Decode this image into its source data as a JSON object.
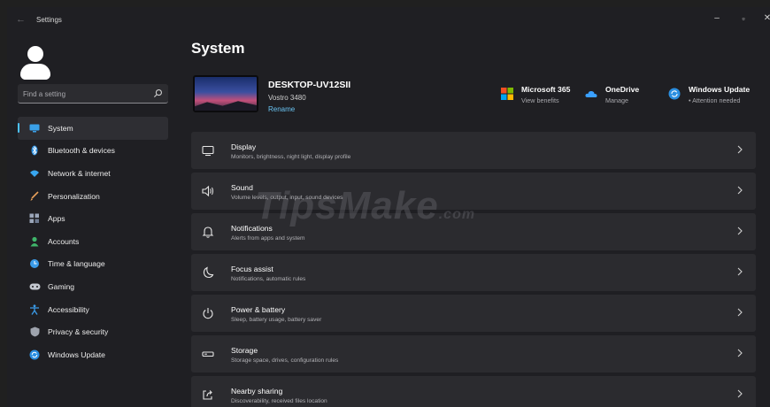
{
  "app": {
    "title": "Settings"
  },
  "window_controls": {
    "minimize": "–",
    "maximize": "▫",
    "close": "✕"
  },
  "search": {
    "placeholder": "Find a setting"
  },
  "sidebar": {
    "items": [
      {
        "label": "System",
        "icon": "display-icon",
        "active": true
      },
      {
        "label": "Bluetooth & devices",
        "icon": "bluetooth-icon"
      },
      {
        "label": "Network & internet",
        "icon": "wifi-icon"
      },
      {
        "label": "Personalization",
        "icon": "brush-icon"
      },
      {
        "label": "Apps",
        "icon": "apps-icon"
      },
      {
        "label": "Accounts",
        "icon": "person-icon"
      },
      {
        "label": "Time & language",
        "icon": "globe-clock-icon"
      },
      {
        "label": "Gaming",
        "icon": "controller-icon"
      },
      {
        "label": "Accessibility",
        "icon": "accessibility-icon"
      },
      {
        "label": "Privacy & security",
        "icon": "shield-icon"
      },
      {
        "label": "Windows Update",
        "icon": "update-icon"
      }
    ]
  },
  "main": {
    "title": "System",
    "device": {
      "name": "DESKTOP-UV12SII",
      "model": "Vostro 3480",
      "rename": "Rename"
    },
    "quick_links": [
      {
        "title": "Microsoft 365",
        "subtitle": "View benefits",
        "icon": "microsoft-logo-icon"
      },
      {
        "title": "OneDrive",
        "subtitle": "Manage",
        "icon": "cloud-icon"
      },
      {
        "title": "Windows Update",
        "subtitle": "• Attention needed",
        "icon": "update-icon"
      }
    ],
    "cards": [
      {
        "title": "Display",
        "subtitle": "Monitors, brightness, night light, display profile",
        "icon": "monitor-icon"
      },
      {
        "title": "Sound",
        "subtitle": "Volume levels, output, input, sound devices",
        "icon": "speaker-icon"
      },
      {
        "title": "Notifications",
        "subtitle": "Alerts from apps and system",
        "icon": "bell-icon"
      },
      {
        "title": "Focus assist",
        "subtitle": "Notifications, automatic rules",
        "icon": "moon-icon"
      },
      {
        "title": "Power & battery",
        "subtitle": "Sleep, battery usage, battery saver",
        "icon": "power-icon"
      },
      {
        "title": "Storage",
        "subtitle": "Storage space, drives, configuration rules",
        "icon": "storage-icon"
      },
      {
        "title": "Nearby sharing",
        "subtitle": "Discoverability, received files location",
        "icon": "share-icon"
      }
    ]
  },
  "watermark": {
    "text": "TipsMake",
    "suffix": ".com"
  },
  "colors": {
    "accent": "#4cc2ff",
    "background": "#1f1f23",
    "card": "#2b2b2f"
  }
}
